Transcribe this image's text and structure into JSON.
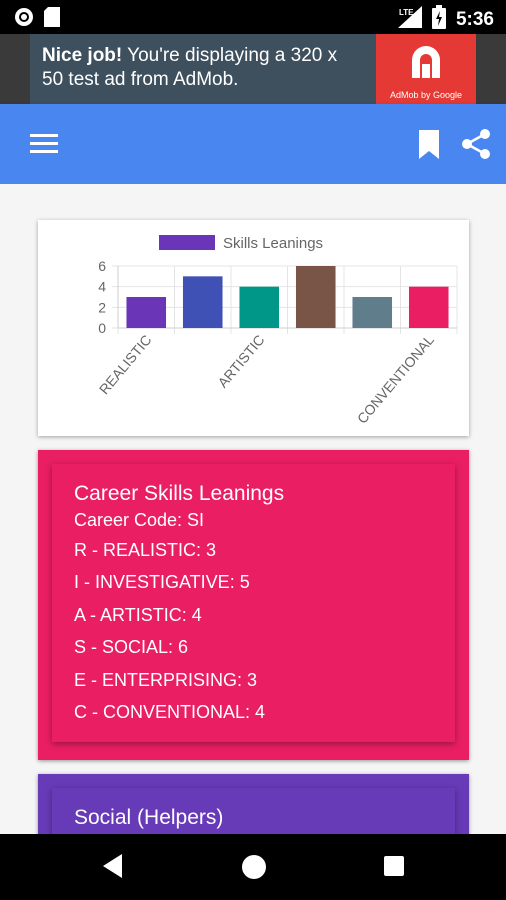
{
  "status_bar": {
    "time": "5:36",
    "network": "LTE"
  },
  "ad": {
    "bold": "Nice job!",
    "text": " You're displaying a 320 x 50 test ad from AdMob.",
    "logo_caption": "AdMob by Google"
  },
  "colors": {
    "app_bar": "#4a86f0",
    "skills_card": "#e91e63",
    "social_card": "#673ab7"
  },
  "toolbar": {
    "icons": [
      "menu-icon",
      "bookmark-icon",
      "share-icon"
    ]
  },
  "chart_data": {
    "type": "bar",
    "legend": "Skills Leanings",
    "categories": [
      "REALISTIC",
      "INVESTIGATIVE",
      "ARTISTIC",
      "SOCIAL",
      "ENTERPRISING",
      "CONVENTIONAL"
    ],
    "values": [
      3,
      5,
      4,
      6,
      3,
      4
    ],
    "bar_colors": [
      "#6a35b6",
      "#3f51b5",
      "#009688",
      "#795548",
      "#607d8b",
      "#e91e63"
    ],
    "visible_tick_labels": [
      "REALISTIC",
      "ARTISTIC",
      "CONVENTIONAL"
    ],
    "y_ticks": [
      "0",
      "2",
      "4",
      "6"
    ],
    "ylim": [
      0,
      6
    ],
    "legend_position": "top",
    "grid": true
  },
  "skills_card": {
    "title": "Career Skills Leanings",
    "code": "Career Code: SI",
    "items": [
      "R - REALISTIC: 3",
      "I - INVESTIGATIVE: 5",
      "A - ARTISTIC: 4",
      "S - SOCIAL: 6",
      "E - ENTERPRISING: 3",
      "C - CONVENTIONAL: 4"
    ]
  },
  "social_card": {
    "title": "Social (Helpers)"
  }
}
